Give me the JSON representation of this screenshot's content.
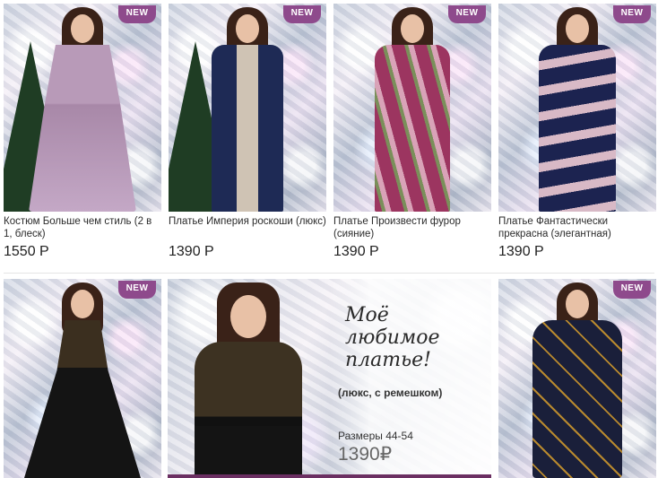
{
  "products": [
    {
      "title": "Костюм Больше чем стиль (2 в 1, блеск)",
      "price": "1550 Р",
      "badge": "NEW",
      "outfit_color": "#b89ab8"
    },
    {
      "title": "Платье Империя роскоши (люкс)",
      "price": "1390 Р",
      "badge": "NEW",
      "outfit_color": "#1e2a55"
    },
    {
      "title": "Платье Произвести фурор (сияние)",
      "price": "1390 Р",
      "badge": "NEW",
      "outfit_color": "#9c3560"
    },
    {
      "title": "Платье Фантастически прекрасна (элегантная)",
      "price": "1390 Р",
      "badge": "NEW",
      "outfit_color": "#1c2350"
    },
    {
      "badge": "NEW",
      "outfit_color": "#141414"
    },
    {
      "badge": "NEW",
      "outfit_color": "#1a1f3a"
    }
  ],
  "banner": {
    "script_line1": "Моё",
    "script_line2": "любимое",
    "script_line3": "платье!",
    "subtitle": "(люкс, с ремешком)",
    "sizes": "Размеры 44-54",
    "price": "1390₽"
  },
  "colors": {
    "badge": "#8e4a8c",
    "accent_bar": "#6b2f62"
  }
}
